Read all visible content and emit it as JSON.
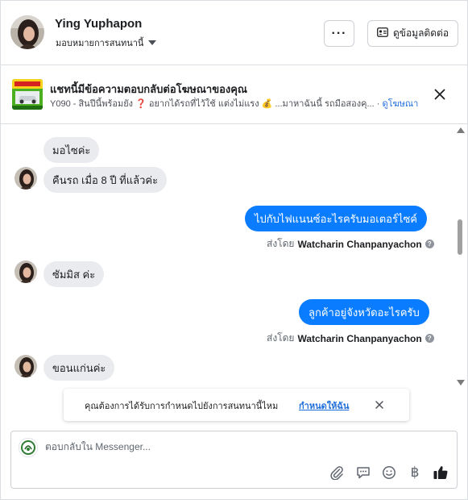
{
  "header": {
    "name": "Ying Yuphapon",
    "assign_label": "มอบหมายการสนทนานี้",
    "more_label": "···",
    "contact_label": "ดูข้อมูลติดต่อ"
  },
  "ad": {
    "title": "แชทนี้มีข้อความตอบกลับต่อโฆษณาของคุณ",
    "subtitle": "Y090 - สินปีนี้พร้อมยัง ❓ อยากได้รถที่ไว้ใช้ แต่งไม่แรง 💰 ...มาหาฉันนี้ รถมือสองคุ... ·",
    "link": "ดูโฆษณา"
  },
  "messages": {
    "in_1": "มอไซค่ะ",
    "in_2": "คืนรถ เมื่อ 8 ปี ที่แล้วค่ะ",
    "out_1": "ไปกับไฟแนนซ์อะไรครับมอเตอร์ไซค์",
    "sent_by_prefix": "ส่งโดย",
    "sent_by_name": "Watcharin Chanpanyachon",
    "in_3": "ซัมมิส ค่ะ",
    "out_2": "ลูกค้าอยู่จังหวัดอะไรครับ",
    "in_4": "ขอนแก่นค่ะ"
  },
  "toast": {
    "text": "คุณต้องการได้รับการกำหนดไปยังการสนทนานี้ไหม",
    "link": "กำหนดให้ฉัน"
  },
  "composer": {
    "placeholder": "ตอบกลับใน Messenger...",
    "currency_symbol": "฿"
  },
  "colors": {
    "outgoing_bubble": "#0a7cff",
    "incoming_bubble": "#e9ebee",
    "link": "#216fdb"
  },
  "icons": {
    "more": "ellipsis-icon",
    "contact": "contact-card-icon",
    "close": "close-icon",
    "attach": "paperclip-icon",
    "saved_reply": "chat-bubble-icon",
    "emoji": "smiley-icon",
    "payment": "baht-icon",
    "like": "thumbs-up-icon"
  }
}
